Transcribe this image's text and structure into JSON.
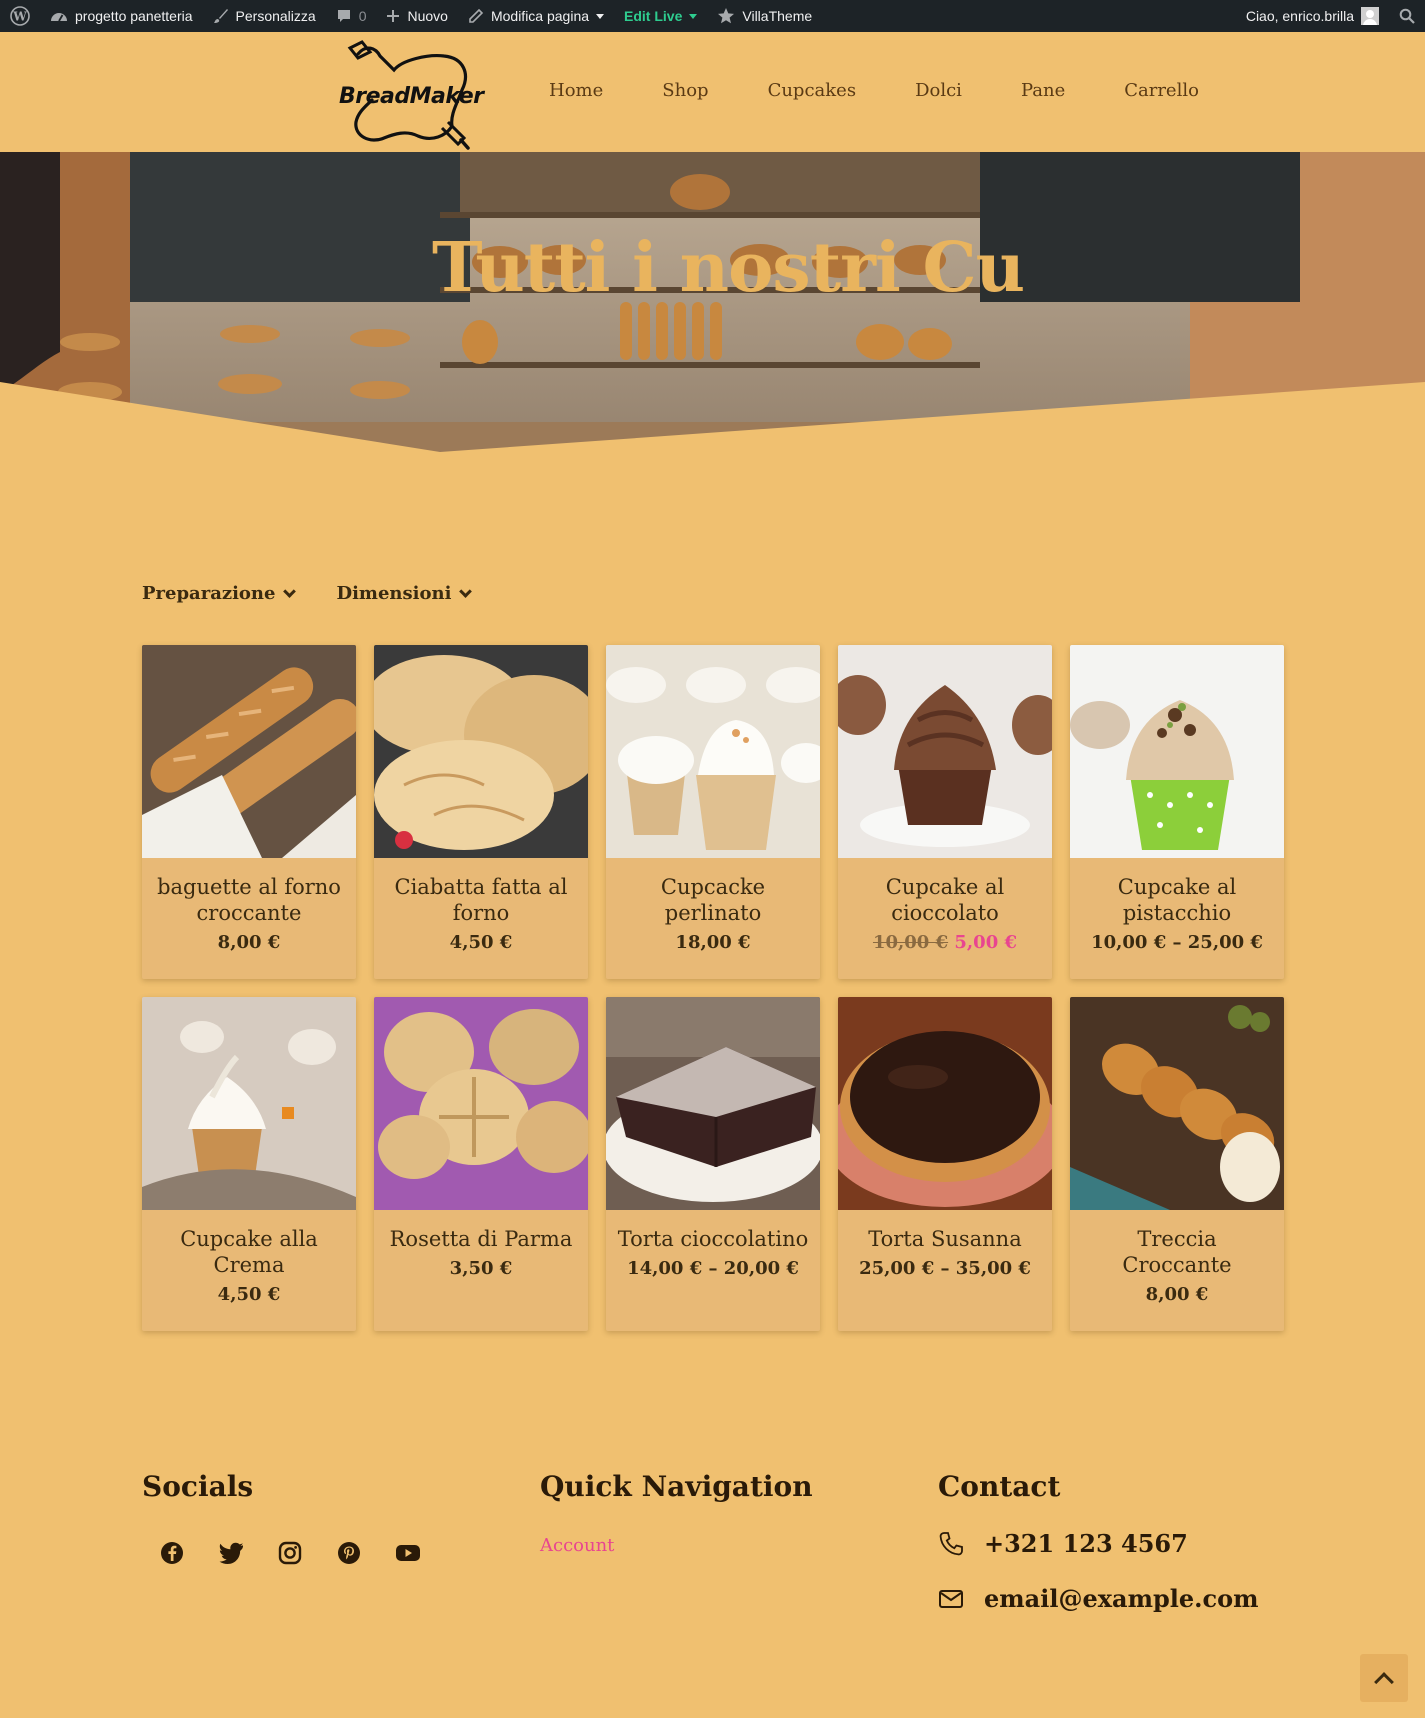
{
  "admin_bar": {
    "site_name": "progetto panetteria",
    "customize": "Personalizza",
    "comments_count": "0",
    "new": "Nuovo",
    "edit_page": "Modifica pagina",
    "edit_live": "Edit Live",
    "theme": "VillaTheme",
    "greeting": "Ciao, enrico.brilla"
  },
  "header": {
    "logo_text": "BreadMaker",
    "nav": [
      "Home",
      "Shop",
      "Cupcakes",
      "Dolci",
      "Pane",
      "Carrello"
    ]
  },
  "hero": {
    "title": "Tutti i nostri Cu"
  },
  "filters": [
    "Preparazione",
    "Dimensioni"
  ],
  "products": [
    {
      "title": "baguette al forno croccante",
      "price": "8,00 €",
      "image": "baguette"
    },
    {
      "title": "Ciabatta fatta al forno",
      "price": "4,50 €",
      "image": "ciabatta"
    },
    {
      "title": "Cupcacke perlinato",
      "price": "18,00 €",
      "image": "cupcake-cream"
    },
    {
      "title": "Cupcake al cioccolato",
      "price_old": "10,00 €",
      "price": "5,00 €",
      "image": "cupcake-chocolate"
    },
    {
      "title": "Cupcake al pistacchio",
      "price": "10,00 € – 25,00 €",
      "image": "cupcake-pistachio"
    },
    {
      "title": "Cupcake alla Crema",
      "price": "4,50 €",
      "image": "cupcake-crema"
    },
    {
      "title": "Rosetta di Parma",
      "price": "3,50 €",
      "image": "rosetta"
    },
    {
      "title": "Torta cioccolatino",
      "price": "14,00 € – 20,00 €",
      "image": "torta-cioccolatino"
    },
    {
      "title": "Torta Susanna",
      "price": "25,00 € – 35,00 €",
      "image": "torta-susanna"
    },
    {
      "title": "Treccia Croccante",
      "price": "8,00 €",
      "image": "treccia"
    }
  ],
  "footer": {
    "socials_title": "Socials",
    "social_icons": [
      "facebook-icon",
      "twitter-icon",
      "instagram-icon",
      "pinterest-icon",
      "youtube-icon"
    ],
    "nav_title": "Quick Navigation",
    "nav_link": "Account",
    "contact_title": "Contact",
    "phone": "+321 123 4567",
    "email": "email@example.com"
  },
  "colors": {
    "background": "#f0c070",
    "card": "#e8b976",
    "sale": "#e84590",
    "admin_bar": "#1d2327",
    "edit_live": "#2ecc8f"
  }
}
